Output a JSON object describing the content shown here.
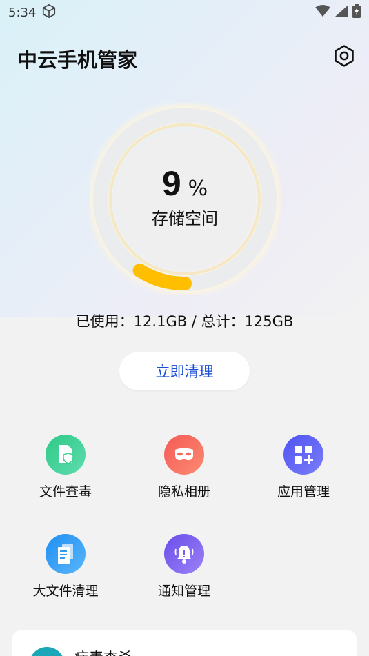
{
  "status_bar": {
    "time": "5:34",
    "icons": [
      "cube-icon",
      "wifi-icon",
      "signal-icon",
      "battery-icon"
    ]
  },
  "header": {
    "title": "中云手机管家",
    "settings_icon": "gear-icon"
  },
  "storage": {
    "percent_value": 9,
    "percent_text": "9",
    "percent_sign": "%",
    "label": "存储空间",
    "usage_text": "已使用：12.1GB / 总计：125GB",
    "ring_track_color": "#e9eaec",
    "ring_fill_color": "#ffbf00"
  },
  "clean_button": {
    "label": "立即清理",
    "color": "#1a4fd6"
  },
  "tools": [
    {
      "label": "文件查毒",
      "icon": "file-shield-icon",
      "color": "#3ccf8e"
    },
    {
      "label": "隐私相册",
      "icon": "mask-icon",
      "color": "#f7665b"
    },
    {
      "label": "应用管理",
      "icon": "app-grid-icon",
      "color": "#5b5ef5"
    },
    {
      "label": "大文件清理",
      "icon": "document-icon",
      "color": "#2d9cf5"
    },
    {
      "label": "通知管理",
      "icon": "bell-icon",
      "color": "#7a5bf0"
    }
  ],
  "bottom_card": {
    "title": "病毒查杀"
  }
}
